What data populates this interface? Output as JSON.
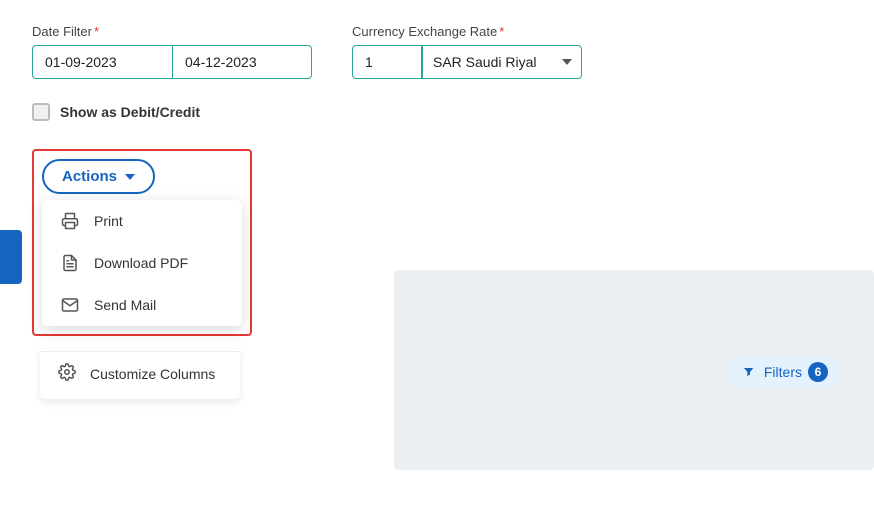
{
  "header": {
    "date_filter_label": "Date Filter",
    "date_start": "01-09-2023",
    "date_end": "04-12-2023",
    "currency_label": "Currency Exchange Rate",
    "currency_value": "1",
    "currency_select_value": "SAR Saudi Riyal",
    "required_star": "*"
  },
  "checkbox": {
    "label": "Show as Debit/Credit"
  },
  "actions": {
    "button_label": "Actions",
    "menu_items": [
      {
        "id": "print",
        "label": "Print",
        "icon": "print"
      },
      {
        "id": "download-pdf",
        "label": "Download PDF",
        "icon": "pdf"
      },
      {
        "id": "send-mail",
        "label": "Send Mail",
        "icon": "mail"
      }
    ],
    "customize_label": "Customize Columns"
  },
  "filters": {
    "label": "Filters",
    "count": "6"
  }
}
